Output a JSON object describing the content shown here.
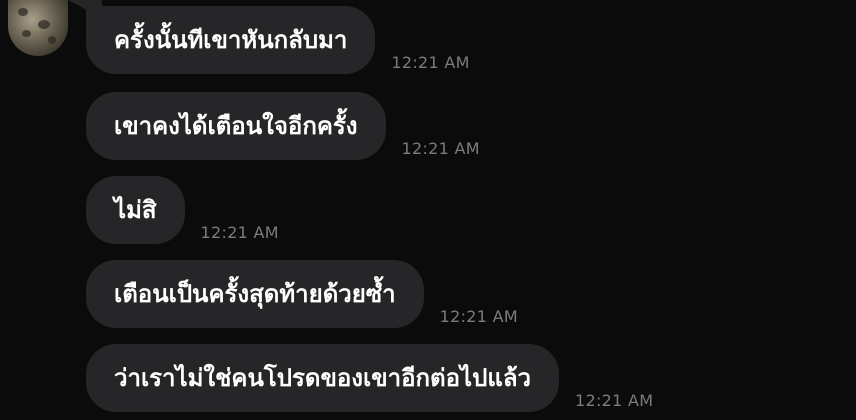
{
  "contact": {
    "avatar_icon": "avatar-photo"
  },
  "messages": [
    {
      "text": "ครั้งนั้นทีเขาหันกลับมา",
      "time": "12:21 AM"
    },
    {
      "text": "เขาคงได้เตือนใจอีกครั้ง",
      "time": "12:21 AM"
    },
    {
      "text": "ไม่สิ",
      "time": "12:21 AM"
    },
    {
      "text": "เตือนเป็นครั้งสุดท้ายด้วยซ้ำ",
      "time": "12:21 AM"
    },
    {
      "text": "ว่าเราไม่ใช่คนโปรดของเขาอีกต่อไปแล้ว",
      "time": "12:21 AM"
    }
  ],
  "colors": {
    "background": "#0b0b0c",
    "bubble": "#262628",
    "text": "#ffffff",
    "timestamp": "#7b7b80"
  }
}
